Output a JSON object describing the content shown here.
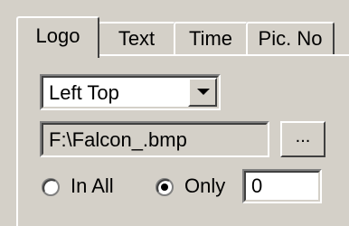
{
  "tabs": [
    {
      "label": "Logo",
      "active": true
    },
    {
      "label": "Text",
      "active": false
    },
    {
      "label": "Time",
      "active": false
    },
    {
      "label": "Pic. No",
      "active": false
    }
  ],
  "position_select": {
    "value": "Left Top"
  },
  "file_path": {
    "value": "F:\\Falcon_.bmp"
  },
  "browse_button": {
    "label": "..."
  },
  "apply_mode": {
    "in_all_label": "In All",
    "only_label": "Only",
    "selected": "only"
  },
  "only_number": {
    "value": "0"
  },
  "colors": {
    "face": "#d4d0c8",
    "highlight": "#ffffff",
    "shadow": "#808080",
    "dark_shadow": "#404040"
  }
}
